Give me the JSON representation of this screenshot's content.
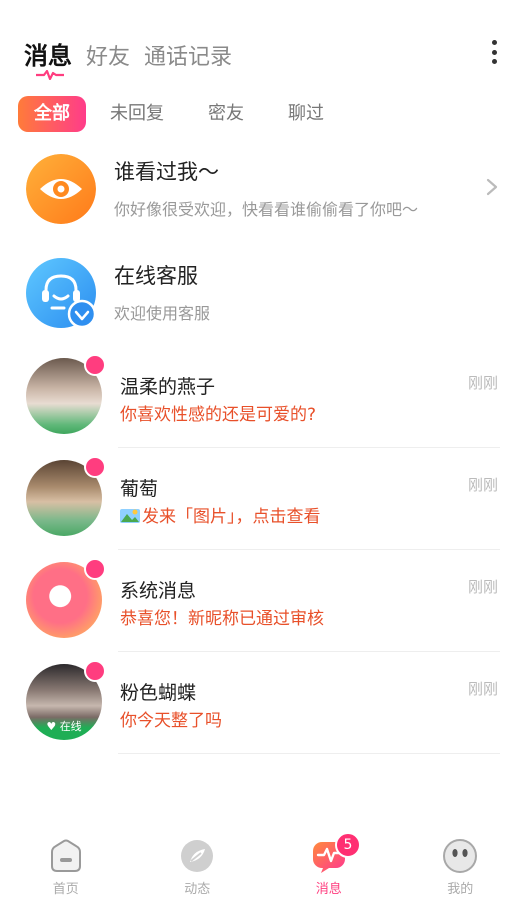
{
  "header": {
    "tabs": [
      {
        "label": "消息",
        "active": true
      },
      {
        "label": "好友",
        "active": false
      },
      {
        "label": "通话记录",
        "active": false
      }
    ]
  },
  "filters": [
    {
      "label": "全部",
      "active": true
    },
    {
      "label": "未回复",
      "active": false
    },
    {
      "label": "密友",
      "active": false
    },
    {
      "label": "聊过",
      "active": false
    }
  ],
  "features": [
    {
      "title": "谁看过我～",
      "subtitle": "你好像很受欢迎，快看看谁偷偷看了你吧～",
      "icon": "eye-icon"
    },
    {
      "title": "在线客服",
      "subtitle": "欢迎使用客服",
      "icon": "headset-icon"
    }
  ],
  "conversations": [
    {
      "name": "温柔的燕子",
      "message": "你喜欢性感的还是可爱的?",
      "time": "刚刚",
      "has_image_icon": false
    },
    {
      "name": "葡萄",
      "message": "发来「图片」，点击查看",
      "time": "刚刚",
      "has_image_icon": true
    },
    {
      "name": "系统消息",
      "message": "恭喜您！新昵称已通过审核",
      "time": "刚刚",
      "has_image_icon": false
    },
    {
      "name": "粉色蝴蝶",
      "message": "你今天整了吗",
      "time": "刚刚",
      "has_image_icon": false,
      "avatar_tag": "在线"
    }
  ],
  "bottom_nav": {
    "items": [
      {
        "label": "首页",
        "icon": "home-icon",
        "active": false
      },
      {
        "label": "动态",
        "icon": "compass-icon",
        "active": false
      },
      {
        "label": "消息",
        "icon": "message-pulse-icon",
        "active": true,
        "badge": "5"
      },
      {
        "label": "我的",
        "icon": "face-icon",
        "active": false
      }
    ]
  },
  "colors": {
    "accent": "#ff3d7f",
    "accent_gradient_start": "#ff7b3a",
    "message_text": "#e8502a"
  }
}
